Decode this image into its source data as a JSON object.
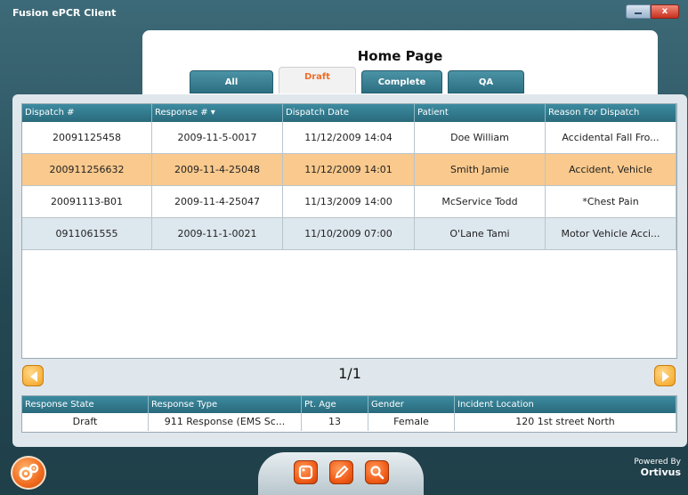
{
  "window": {
    "title": "Fusion ePCR Client",
    "close_glyph": "x"
  },
  "header": {
    "title": "Home Page"
  },
  "tabs": [
    {
      "label": "All"
    },
    {
      "label": "Draft"
    },
    {
      "label": "Complete"
    },
    {
      "label": "QA"
    }
  ],
  "grid": {
    "columns": [
      "Dispatch #",
      "Response # ▾",
      "Dispatch Date",
      "Patient",
      "Reason For Dispatch"
    ],
    "rows": [
      [
        "20091125458",
        "2009-11-5-0017",
        "11/12/2009 14:04",
        "Doe William",
        "Accidental Fall Fro..."
      ],
      [
        "200911256632",
        "2009-11-4-25048",
        "11/12/2009 14:01",
        "Smith Jamie",
        "Accident, Vehicle"
      ],
      [
        "20091113-B01",
        "2009-11-4-25047",
        "11/13/2009 14:00",
        "McService Todd",
        "*Chest Pain"
      ],
      [
        "0911061555",
        "2009-11-1-0021",
        "11/10/2009 07:00",
        "O'Lane Tami",
        "Motor Vehicle Acci..."
      ]
    ]
  },
  "pager": {
    "text": "1/1"
  },
  "detail": {
    "columns": [
      "Response State",
      "Response Type",
      "Pt. Age",
      "Gender",
      "Incident Location"
    ],
    "values": [
      "Draft",
      "911 Response (EMS Sc...",
      "13",
      "Female",
      "120 1st street North"
    ]
  },
  "footer": {
    "powered_by": "Powered By",
    "brand": "Ortivus"
  },
  "icons": {
    "settings": "gears-icon",
    "new": "new-record-icon",
    "edit": "pencil-icon",
    "search": "search-icon",
    "prev": "arrow-left-icon",
    "next": "arrow-right-icon"
  },
  "colors": {
    "accent": "#f06a1e",
    "header": "#2a6a7c",
    "selected_row": "#f9c98d"
  }
}
